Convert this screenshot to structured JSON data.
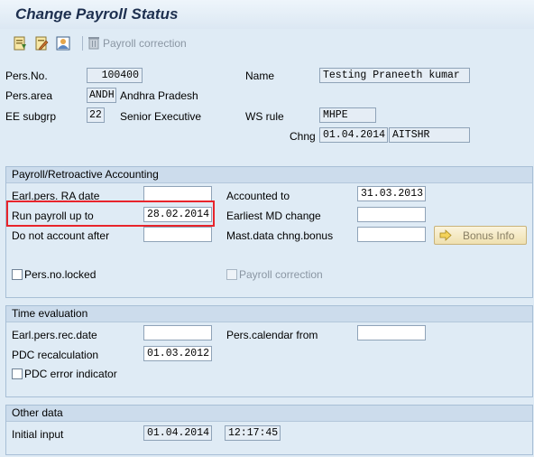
{
  "window": {
    "title": "Change Payroll Status"
  },
  "toolbar": {
    "buttons": [
      {
        "name": "create-icon"
      },
      {
        "name": "change-icon"
      },
      {
        "name": "display-icon"
      }
    ],
    "payroll_correction_label": "Payroll correction"
  },
  "header": {
    "pers_no_label": "Pers.No.",
    "pers_no_value": "100400",
    "name_label": "Name",
    "name_value": "Testing Praneeth kumar",
    "pers_area_label": "Pers.area",
    "pers_area_value": "ANDH",
    "pers_area_text": "Andhra Pradesh",
    "ee_subgrp_label": "EE subgrp",
    "ee_subgrp_value": "22",
    "ee_subgrp_text": "Senior Executive",
    "ws_rule_label": "WS rule",
    "ws_rule_value": "MHPE",
    "chng_label": "Chng",
    "chng_date": "01.04.2014",
    "chng_user": "AITSHR"
  },
  "payroll_group": {
    "title": "Payroll/Retroactive Accounting",
    "earl_ra_label": "Earl.pers. RA date",
    "earl_ra_value": "",
    "run_payroll_label": "Run payroll up to",
    "run_payroll_value": "28.02.2014",
    "do_not_account_label": "Do not account after",
    "do_not_account_value": "",
    "accounted_to_label": "Accounted to",
    "accounted_to_value": "31.03.2013",
    "earliest_md_label": "Earliest MD change",
    "earliest_md_value": "",
    "mast_data_label": "Mast.data chng.bonus",
    "mast_data_value": "",
    "bonus_info_label": "Bonus Info",
    "pers_no_locked_label": "Pers.no.locked",
    "pers_no_locked_checked": false,
    "payroll_correction_label": "Payroll correction",
    "payroll_correction_checked": false
  },
  "time_group": {
    "title": "Time evaluation",
    "earl_rec_label": "Earl.pers.rec.date",
    "earl_rec_value": "",
    "pers_calendar_label": "Pers.calendar from",
    "pers_calendar_value": "",
    "pdc_recalc_label": "PDC recalculation",
    "pdc_recalc_value": "01.03.2012",
    "pdc_error_label": "PDC error indicator",
    "pdc_error_checked": false
  },
  "other_group": {
    "title": "Other data",
    "initial_input_label": "Initial input",
    "initial_input_date": "01.04.2014",
    "initial_input_time": "12:17:45"
  },
  "colors": {
    "highlight": "#e8242b",
    "background": "#dfebf5",
    "title": "#1d2f4f"
  }
}
